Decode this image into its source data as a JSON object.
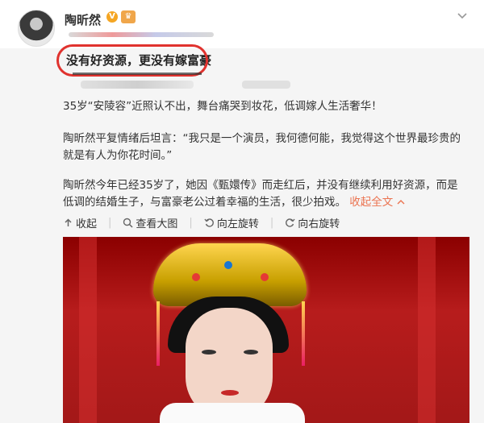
{
  "post": {
    "username": "陶昕然",
    "verified_badge": "V",
    "title": "没有好资源，更没有嫁富豪",
    "paragraph1": "35岁“安陵容”近照认不出，舞台痛哭到妆花，低调嫁人生活奢华！",
    "paragraph2": "陶昕然平复情绪后坦言：“我只是一个演员，我何德何能，我觉得这个世界最珍贵的就是有人为你花时间。”",
    "paragraph3": "陶昕然今年已经35岁了，她因《甄嬛传》而走红后，并没有继续利用好资源，而是低调的结婚生子，与富豪老公过着幸福的生活，很少拍戏。",
    "collapse_label": "收起全文",
    "collapse_icon": "chevron-up-icon"
  },
  "actions": {
    "collapse": "收起",
    "view_large": "查看大图",
    "rotate_left": "向左旋转",
    "rotate_right": "向右旋转"
  },
  "colors": {
    "accent_link": "#eb7350",
    "highlight_oval": "#e0322e",
    "badge": "#f5a623"
  }
}
